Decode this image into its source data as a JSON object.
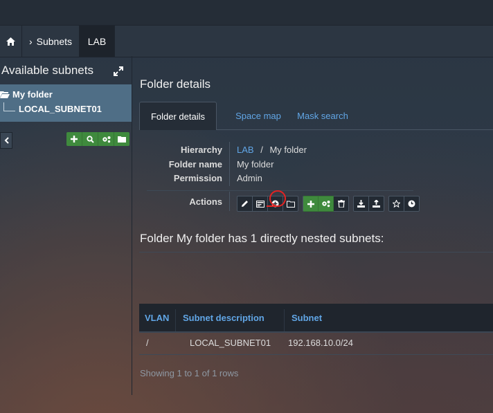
{
  "breadcrumb": {
    "subnets_label": "Subnets",
    "current_label": "LAB"
  },
  "sidebar": {
    "title": "Available subnets",
    "tree": {
      "folder_label": "My folder",
      "subnet_label": "LOCAL_SUBNET01"
    }
  },
  "panel": {
    "title": "Folder details",
    "tabs": [
      "Folder details",
      "Space map",
      "Mask search"
    ]
  },
  "details": {
    "hierarchy_label": "Hierarchy",
    "hierarchy_link": "LAB",
    "hierarchy_sep": "/",
    "hierarchy_current": "My folder",
    "folder_name_label": "Folder name",
    "folder_name_value": "My folder",
    "permission_label": "Permission",
    "permission_value": "Admin",
    "actions_label": "Actions"
  },
  "nested": {
    "title": "Folder My folder has 1 directly nested subnets:"
  },
  "table": {
    "headers": [
      "VLAN",
      "Subnet description",
      "Subnet"
    ],
    "rows": [
      {
        "vlan": "/",
        "description": "LOCAL_SUBNET01",
        "subnet": "192.168.10.0/24"
      }
    ],
    "footer": "Showing 1 to 1 of 1 rows"
  },
  "colors": {
    "accent_link": "#61a6e6",
    "green_button": "#3f8a3d",
    "tree_highlight": "#4f6e86",
    "annotation_red": "#e52222"
  }
}
